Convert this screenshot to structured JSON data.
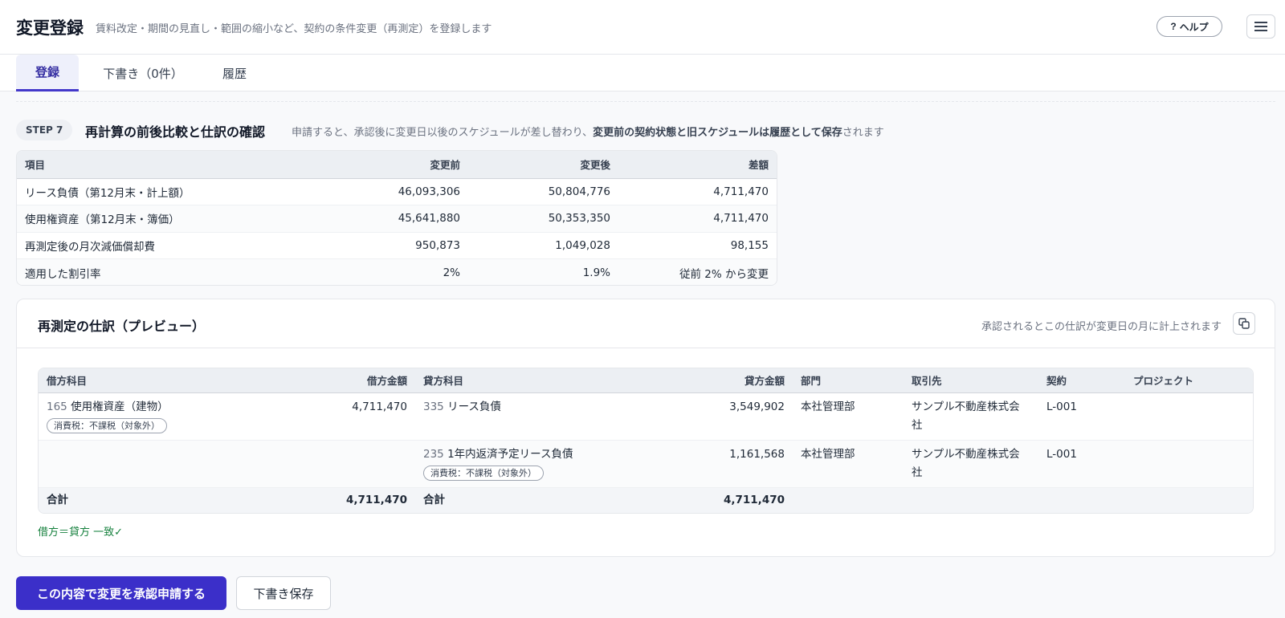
{
  "header": {
    "title": "変更登録",
    "subtitle": "賃料改定・期間の見直し・範囲の縮小など、契約の条件変更（再測定）を登録します",
    "help_mark": "?",
    "help_label": "ヘルプ"
  },
  "tabs": [
    {
      "label": "登録"
    },
    {
      "label": "下書き（0件）"
    },
    {
      "label": "履歴"
    }
  ],
  "step": {
    "badge": "STEP 7",
    "title": "再計算の前後比較と仕訳の確認",
    "desc_prefix": "申請すると、承認後に変更日以後のスケジュールが差し替わり、",
    "desc_bold": "変更前の契約状態と旧スケジュールは履歴として保存",
    "desc_suffix": "されます"
  },
  "compare": {
    "headers": [
      "項目",
      "変更前",
      "変更後",
      "差額"
    ],
    "rows": [
      [
        "リース負債（第12月末・計上額）",
        "46,093,306",
        "50,804,776",
        "4,711,470"
      ],
      [
        "使用権資産（第12月末・簿価）",
        "45,641,880",
        "50,353,350",
        "4,711,470"
      ],
      [
        "再測定後の月次減価償却費",
        "950,873",
        "1,049,028",
        "98,155"
      ],
      [
        "適用した割引率",
        "2%",
        "1.9%",
        "従前 2% から変更"
      ]
    ]
  },
  "journal": {
    "title": "再測定の仕訳（プレビュー）",
    "note": "承認されるとこの仕訳が変更日の月に計上されます",
    "headers": [
      "借方科目",
      "借方金額",
      "貸方科目",
      "貸方金額",
      "部門",
      "取引先",
      "契約",
      "プロジェクト"
    ],
    "rows": [
      {
        "debit_code": "165",
        "debit_name": "使用権資産（建物）",
        "debit_tax": "消費税：不課税（対象外）",
        "debit_amount": "4,711,470",
        "credit_code": "335",
        "credit_name": "リース負債",
        "credit_tax": "",
        "credit_amount": "3,549,902",
        "dept": "本社管理部",
        "partner": "サンプル不動産株式会社",
        "contract": "L-001",
        "project": ""
      },
      {
        "debit_code": "",
        "debit_name": "",
        "debit_tax": "",
        "debit_amount": "",
        "credit_code": "235",
        "credit_name": "1年内返済予定リース負債",
        "credit_tax": "消費税：不課税（対象外）",
        "credit_amount": "1,161,568",
        "dept": "本社管理部",
        "partner": "サンプル不動産株式会社",
        "contract": "L-001",
        "project": ""
      }
    ],
    "total": {
      "debit_label": "合計",
      "debit_amount": "4,711,470",
      "credit_label": "合計",
      "credit_amount": "4,711,470"
    },
    "balance_text": "借方＝貸方 一致✓"
  },
  "actions": {
    "submit_label": "この内容で変更を承認申請する",
    "draft_label": "下書き保存"
  },
  "colors": {
    "accent": "#3b2fc9",
    "negative": "#c62828",
    "ok": "#15803d"
  }
}
